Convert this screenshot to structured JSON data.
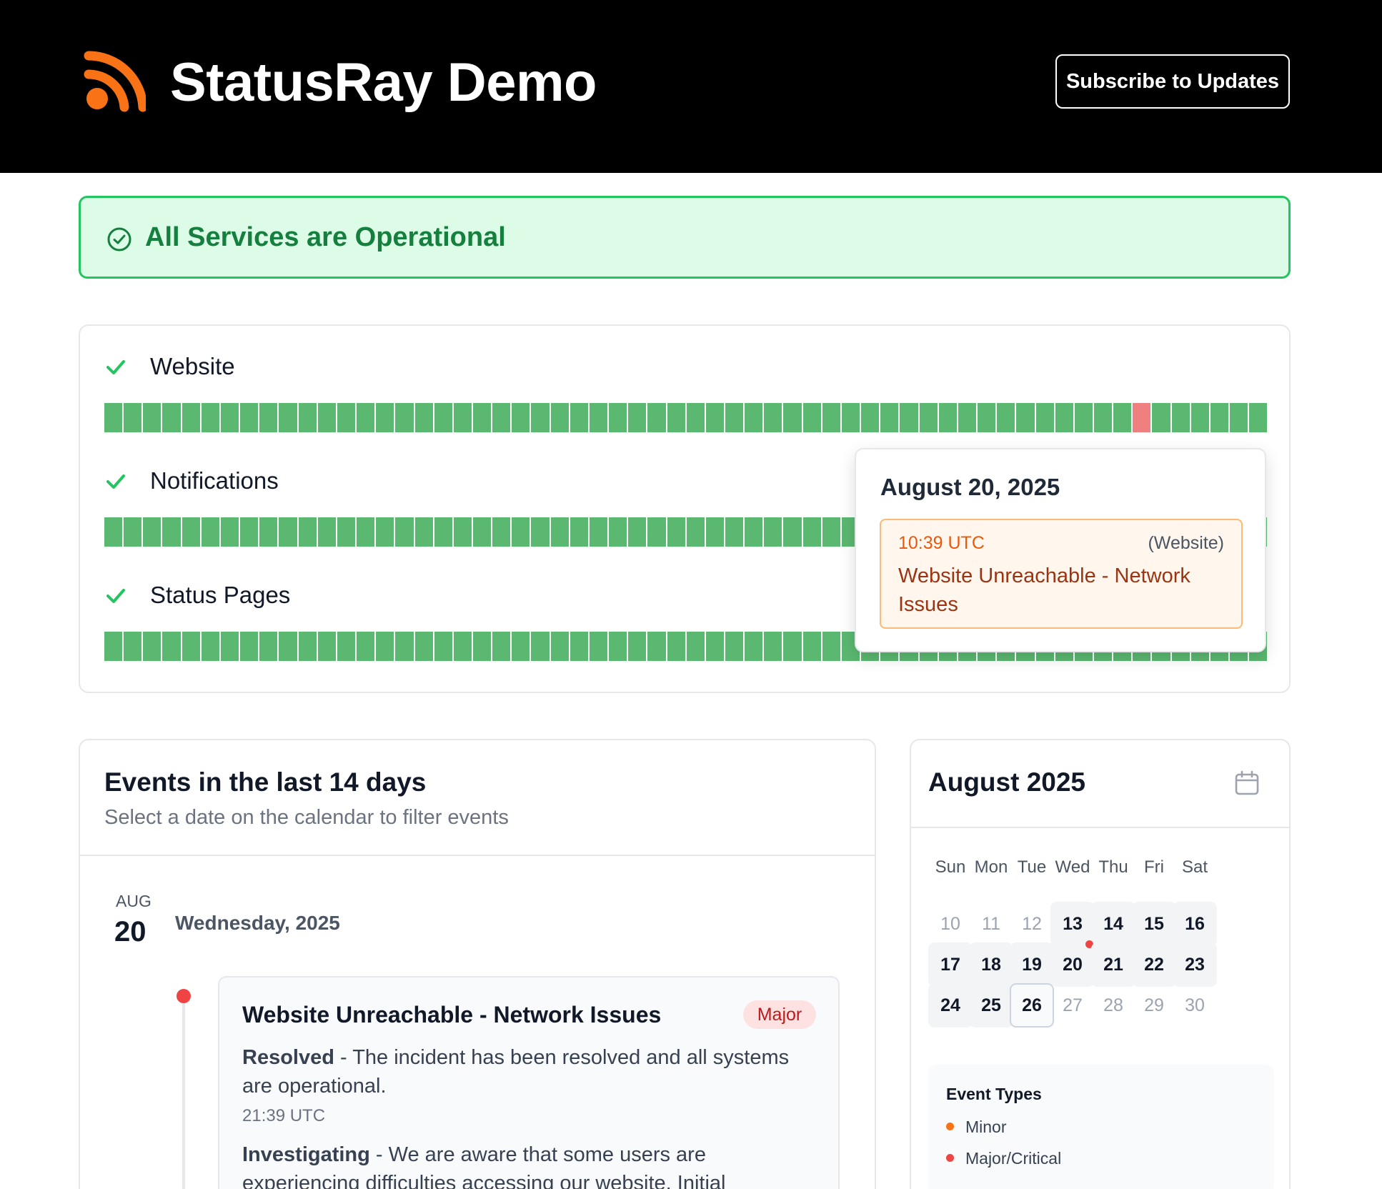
{
  "header": {
    "brand": "StatusRay Demo",
    "logo_icon": "rss-feed-icon",
    "subscribe_label": "Subscribe to Updates",
    "accent_color": "#f97316"
  },
  "banner": {
    "text": "All Services are Operational",
    "icon": "check-circle-icon",
    "color": "#15803d"
  },
  "services": [
    {
      "name": "Website",
      "status": "operational",
      "days": 60,
      "major_day_indexes": [
        53
      ]
    },
    {
      "name": "Notifications",
      "status": "operational",
      "days": 60,
      "major_day_indexes": []
    },
    {
      "name": "Status Pages",
      "status": "operational",
      "days": 60,
      "major_day_indexes": []
    }
  ],
  "tooltip": {
    "date": "August 20, 2025",
    "time": "10:39 UTC",
    "service": "(Website)",
    "title": "Website Unreachable - Network Issues"
  },
  "events": {
    "title": "Events in the last 14 days",
    "subtitle": "Select a date on the calendar to filter events",
    "month": "AUG",
    "day": "20",
    "weekday": "Wednesday, 2025",
    "incident": {
      "title": "Website Unreachable - Network Issues",
      "badge": "Major",
      "update1_status": "Resolved",
      "update1_text": " - The incident has been resolved and all systems are operational.",
      "update1_time": "21:39 UTC",
      "update2_status": "Investigating",
      "update2_text": " - We are aware that some users are experiencing difficulties accessing our website. Initial investigation indicates"
    }
  },
  "calendar": {
    "title": "August 2025",
    "weekdays": [
      "Sun",
      "Mon",
      "Tue",
      "Wed",
      "Thu",
      "Fri",
      "Sat"
    ],
    "weeks": [
      [
        "10",
        "11",
        "12",
        "13",
        "14",
        "15",
        "16"
      ],
      [
        "17",
        "18",
        "19",
        "20",
        "21",
        "22",
        "23"
      ],
      [
        "24",
        "25",
        "26",
        "27",
        "28",
        "29",
        "30"
      ]
    ],
    "muted_days": [
      "10",
      "11",
      "12",
      "27",
      "28",
      "29",
      "30"
    ],
    "today": "26",
    "event_days": [
      "20"
    ],
    "legend_title": "Event Types",
    "legend": [
      {
        "label": "Minor",
        "color": "#f97316"
      },
      {
        "label": "Major/Critical",
        "color": "#ef4444"
      }
    ]
  }
}
